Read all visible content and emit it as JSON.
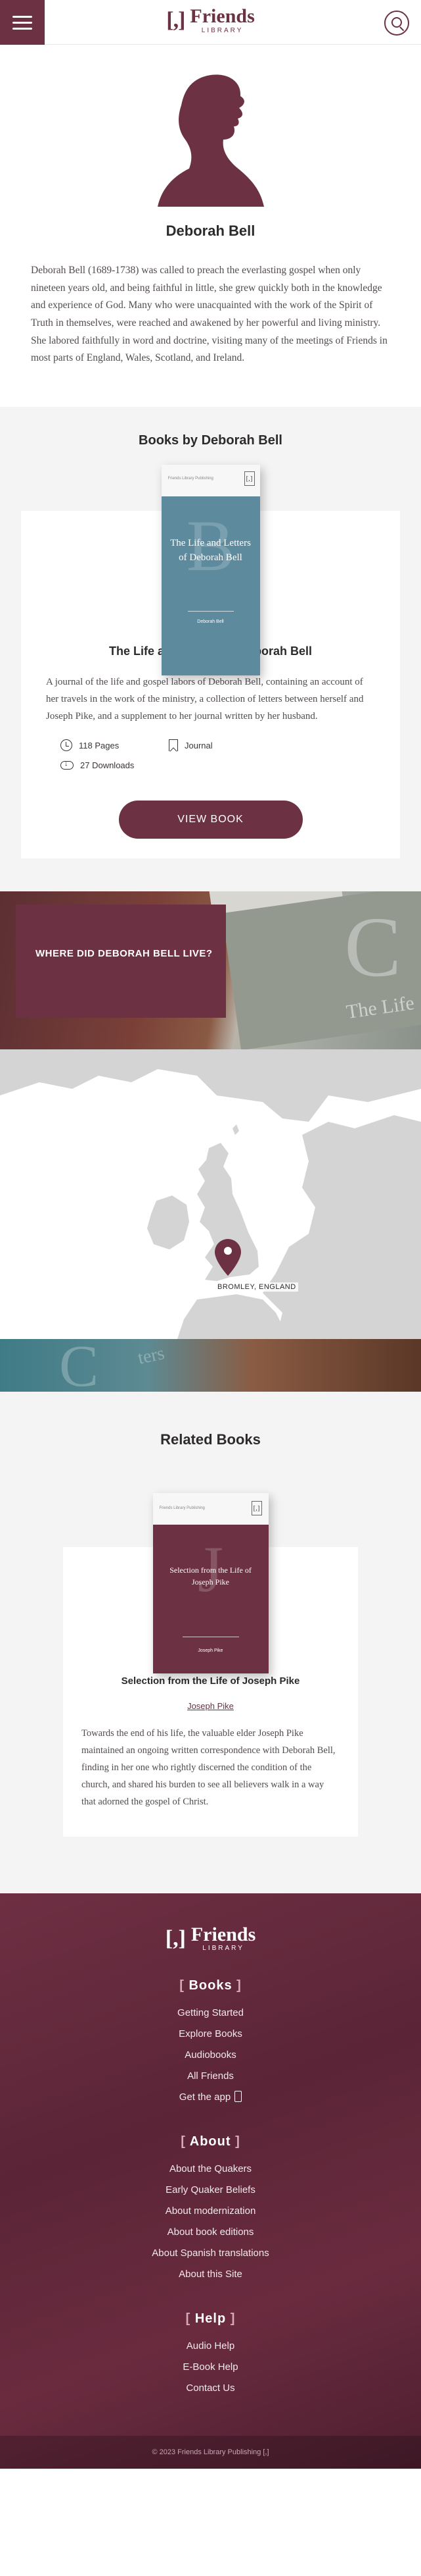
{
  "header": {
    "logo_mark": "[,]",
    "logo_word": "Friends",
    "logo_sub": "LIBRARY"
  },
  "author": {
    "name": "Deborah Bell",
    "bio": "Deborah Bell (1689-1738) was called to preach the everlasting gospel when only nineteen years old, and being faithful in little, she grew quickly both in the knowledge and experience of God. Many who were unacquainted with the work of the Spirit of Truth in themselves, were reached and awakened by her powerful and living ministry. She labored faithfully in word and doctrine, visiting many of the meetings of Friends in most parts of England, Wales, Scotland, and Ireland."
  },
  "books": {
    "section_title": "Books by Deborah Bell",
    "items": [
      {
        "cover_series": "Friends Library Publishing",
        "cover_letter": "B",
        "cover_title": "The Life and Letters of Deborah Bell",
        "cover_author": "Deborah Bell",
        "title": "The Life and Letters of Deborah Bell",
        "description": "A journal of the life and gospel labors of Deborah Bell, containing an account of her travels in the work of the ministry, a collection of letters between herself and Joseph Pike, and a supplement to her journal written by her husband.",
        "pages": "118 Pages",
        "type": "Journal",
        "downloads": "27 Downloads",
        "button": "VIEW BOOK"
      }
    ]
  },
  "where": {
    "heading": "WHERE DID DEBORAH BELL LIVE?",
    "art_letter": "C",
    "art_text": "The Life",
    "map_pin_label": "BROMLEY, ENGLAND"
  },
  "strip": {
    "letter": "C",
    "text": "ters"
  },
  "related": {
    "section_title": "Related Books",
    "items": [
      {
        "cover_series": "Friends Library Publishing",
        "cover_letter": "J",
        "cover_title": "Selection from the Life of Joseph Pike",
        "cover_author": "Joseph Pike",
        "title": "Selection from the Life of Joseph Pike",
        "author": "Joseph Pike",
        "description": "Towards the end of his life, the valuable elder Joseph Pike maintained an ongoing written correspondence with Deborah Bell, finding in her one who rightly discerned the condition of the church, and shared his burden to see all believers walk in a way that adorned the gospel of Christ."
      }
    ]
  },
  "footer": {
    "logo_mark": "[,]",
    "logo_word": "Friends",
    "logo_sub": "LIBRARY",
    "sections": [
      {
        "heading": "Books",
        "links": [
          "Getting Started",
          "Explore Books",
          "Audiobooks",
          "All Friends",
          "Get the app"
        ]
      },
      {
        "heading": "About",
        "links": [
          "About the Quakers",
          "Early Quaker Beliefs",
          "About modernization",
          "About book editions",
          "About Spanish translations",
          "About this Site"
        ]
      },
      {
        "heading": "Help",
        "links": [
          "Audio Help",
          "E-Book Help",
          "Contact Us"
        ]
      }
    ],
    "copyright": "© 2023 Friends Library Publishing [,]"
  },
  "colors": {
    "brand": "#6c3142",
    "book_cover_blue": "#5d8a9d",
    "map_land": "#d4d4d4",
    "map_water": "#ffffff"
  }
}
